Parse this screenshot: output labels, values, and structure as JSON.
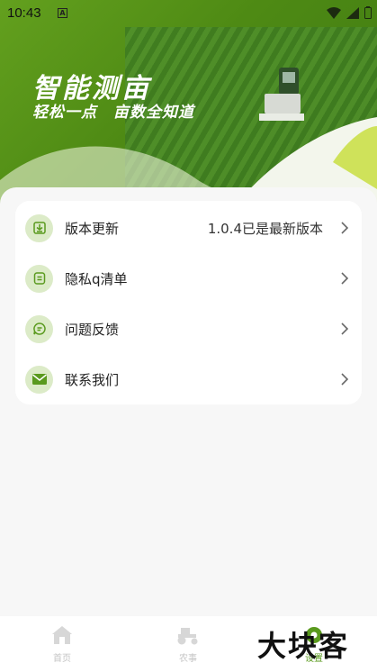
{
  "status_bar": {
    "time": "10:43",
    "sim_badge": "A"
  },
  "hero": {
    "title": "智能测亩",
    "subtitle": "轻松一点　亩数全知道"
  },
  "menu": [
    {
      "label": "版本更新",
      "value": "1.0.4已是最新版本",
      "icon": "download-icon"
    },
    {
      "label": "隐私q清单",
      "value": "",
      "icon": "document-icon"
    },
    {
      "label": "问题反馈",
      "value": "",
      "icon": "chat-bubble-icon"
    },
    {
      "label": "联系我们",
      "value": "",
      "icon": "mail-icon"
    }
  ],
  "tabs": [
    {
      "label": "首页",
      "icon": "home-icon"
    },
    {
      "label": "农事",
      "icon": "tractor-icon"
    },
    {
      "label": "设置",
      "icon": "settings-icon",
      "active": true
    }
  ],
  "watermark": "大块客",
  "colors": {
    "accent": "#5a9a1e",
    "icon_bg": "#dcebc8"
  }
}
